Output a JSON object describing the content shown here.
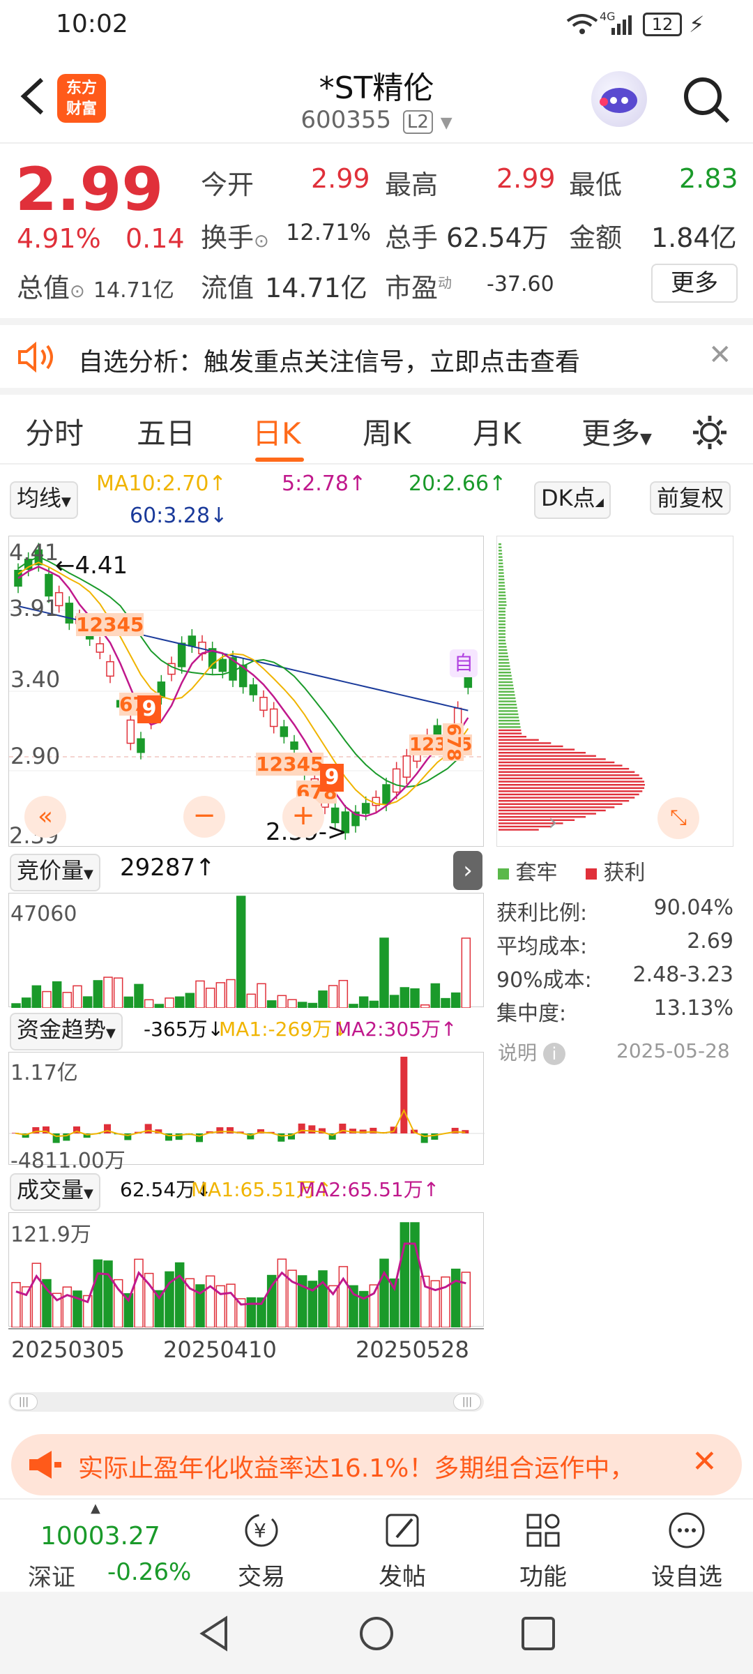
{
  "status": {
    "time": "10:02",
    "net": "4G",
    "battery": "12"
  },
  "header": {
    "back_icon": "back-arrow-icon",
    "logo_line1": "东方",
    "logo_line2": "财富",
    "title": "*ST精伦",
    "code": "600355",
    "level": "L2"
  },
  "quote": {
    "price": "2.99",
    "pct": "4.91%",
    "change": "0.14",
    "open_label": "今开",
    "open": "2.99",
    "high_label": "最高",
    "high": "2.99",
    "low_label": "最低",
    "low": "2.83",
    "turnover_label": "换手",
    "turnover": "12.71%",
    "volume_label": "总手",
    "volume": "62.54万",
    "amount_label": "金额",
    "amount": "1.84亿",
    "mcap_label": "总值",
    "mcap": "14.71亿",
    "float_label": "流值",
    "float": "14.71亿",
    "pe_label": "市盈",
    "pe_sup": "动",
    "pe": "-37.60",
    "more": "更多"
  },
  "banner": {
    "text": "自选分析：触发重点关注信号，立即点击查看"
  },
  "tabs": [
    "分时",
    "五日",
    "日K",
    "周K",
    "月K",
    "更多"
  ],
  "active_tab": "日K",
  "ma": {
    "selector": "均线",
    "ma10": "MA10:2.70↑",
    "ma5": "5:2.78↑",
    "ma20": "20:2.66↑",
    "ma60": "60:3.28↓",
    "dk": "DK点",
    "fq": "前复权"
  },
  "kchart": {
    "y1": "4.41",
    "y2": "3.91",
    "y3": "3.40",
    "y4": "2.90",
    "y5": "2.39",
    "high_note": "←4.41",
    "low_note": "2.39->",
    "auto": "自",
    "nine_a": "9",
    "nine_b": "9",
    "seq_a": "12345",
    "seq_b": "678",
    "seq_c": "12345",
    "seq_d": "678",
    "seq_e": "12345",
    "seq_f": "678"
  },
  "chips": {
    "legend_trap": "套牢",
    "legend_profit": "获利",
    "rows": [
      [
        "获利比例:",
        "90.04%"
      ],
      [
        "平均成本:",
        "2.69"
      ],
      [
        "90%成本:",
        "2.48-3.23"
      ],
      [
        "集中度:",
        "13.13%"
      ]
    ],
    "note": "说明",
    "date": "2025-05-28"
  },
  "auction": {
    "selector": "竞价量",
    "value": "29287↑",
    "ymax": "47060"
  },
  "fund": {
    "selector": "资金趋势",
    "value": "-365万↓",
    "ma1": "MA1:-269万↓",
    "ma2": "MA2:305万↑",
    "ymax": "1.17亿",
    "ymin": "-4811.00万"
  },
  "vol": {
    "selector": "成交量",
    "value": "62.54万↓",
    "ma1": "MA1:65.51万↑",
    "ma2": "MA2:65.51万↑",
    "ymax": "121.9万"
  },
  "xaxis": [
    "20250305",
    "20250410",
    "20250528"
  ],
  "ad": {
    "text": "实际止盈年化收益率达16.1%！多期组合运作中，"
  },
  "index": {
    "value": "10003.27",
    "name": "深证",
    "pct": "-0.26%"
  },
  "nav": [
    "交易",
    "发帖",
    "功能",
    "设自选"
  ],
  "colors": {
    "up": "#e0303a",
    "down": "#1a9a2a",
    "accent": "#ff6a1a",
    "ma5": "#c0188c",
    "ma10": "#f0b400",
    "ma20": "#1a9a2a",
    "ma60": "#1a3a9a"
  }
}
